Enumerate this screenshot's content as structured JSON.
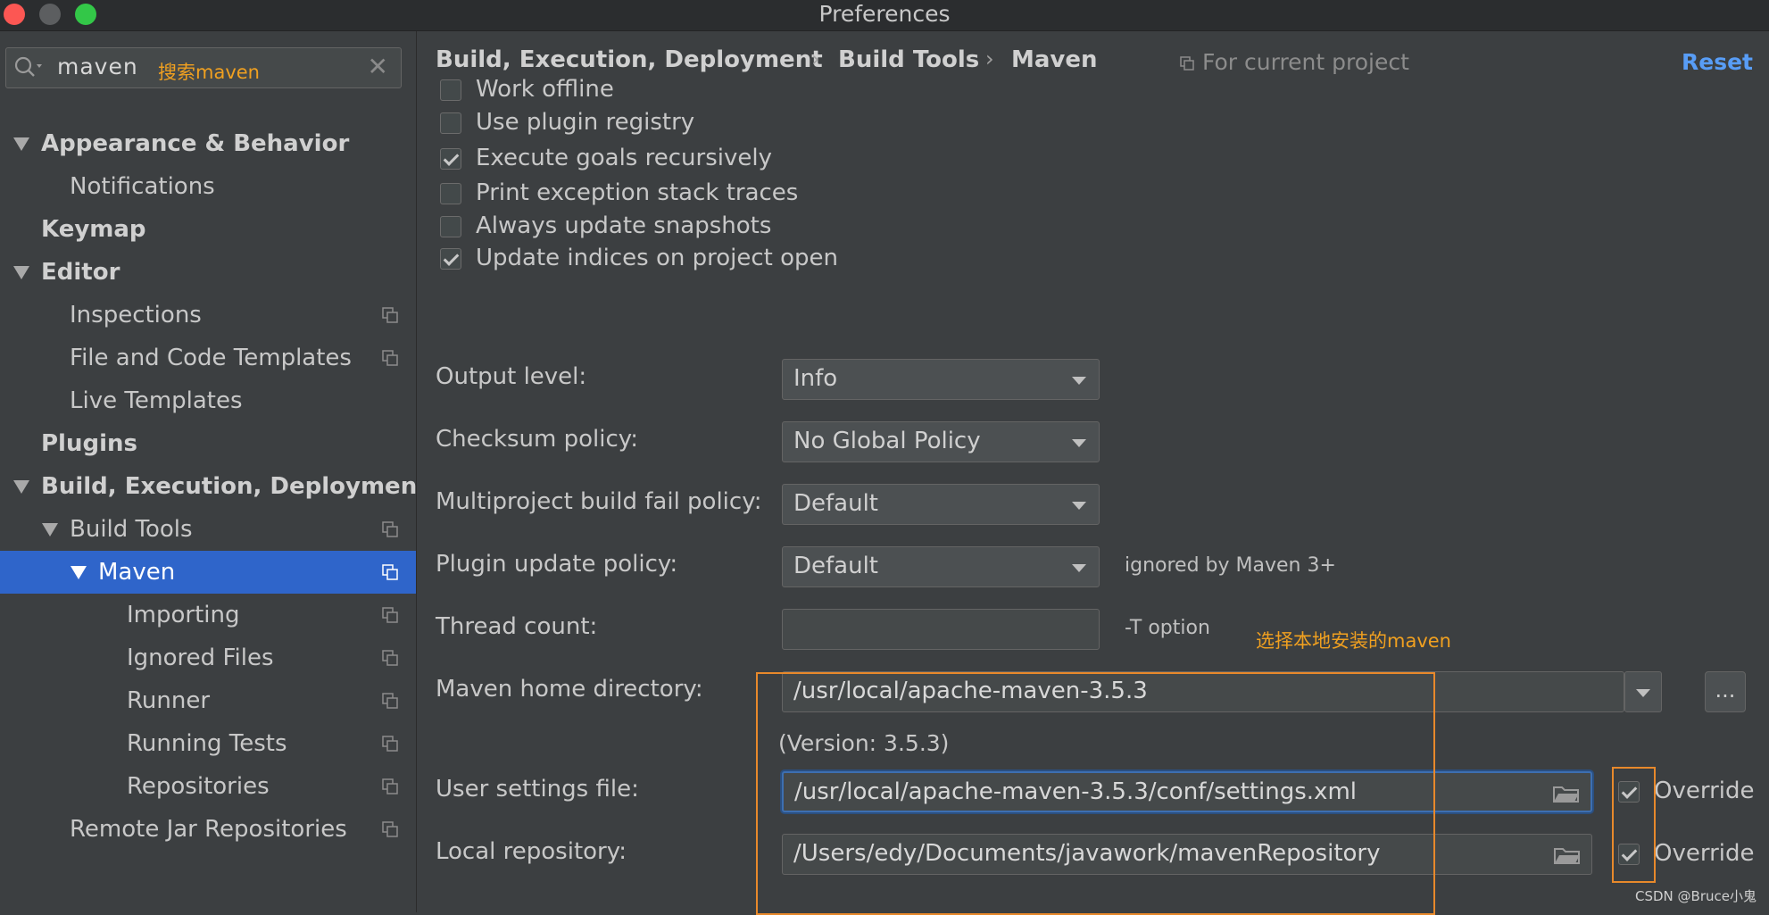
{
  "window": {
    "title": "Preferences"
  },
  "colors": {
    "accent": "#2f65ca",
    "link": "#589df6",
    "annotation": "#e8892b"
  },
  "search": {
    "value": "maven",
    "annotation": "搜索maven",
    "clear_icon": "close-icon"
  },
  "sidebar": {
    "items": [
      {
        "label": "Appearance & Behavior",
        "level": 0,
        "bold": true,
        "expanded": true,
        "copy": false,
        "selected": false
      },
      {
        "label": "Notifications",
        "level": 1,
        "bold": false,
        "expanded": false,
        "copy": false,
        "selected": false
      },
      {
        "label": "Keymap",
        "level": 0,
        "bold": true,
        "expanded": false,
        "copy": false,
        "selected": false
      },
      {
        "label": "Editor",
        "level": 0,
        "bold": true,
        "expanded": true,
        "copy": false,
        "selected": false
      },
      {
        "label": "Inspections",
        "level": 1,
        "bold": false,
        "expanded": false,
        "copy": true,
        "selected": false
      },
      {
        "label": "File and Code Templates",
        "level": 1,
        "bold": false,
        "expanded": false,
        "copy": true,
        "selected": false
      },
      {
        "label": "Live Templates",
        "level": 1,
        "bold": false,
        "expanded": false,
        "copy": false,
        "selected": false
      },
      {
        "label": "Plugins",
        "level": 0,
        "bold": true,
        "expanded": false,
        "copy": false,
        "selected": false
      },
      {
        "label": "Build, Execution, Deployment",
        "level": 0,
        "bold": true,
        "expanded": true,
        "copy": false,
        "selected": false
      },
      {
        "label": "Build Tools",
        "level": 1,
        "bold": false,
        "expanded": true,
        "copy": true,
        "selected": false
      },
      {
        "label": "Maven",
        "level": 2,
        "bold": false,
        "expanded": true,
        "copy": true,
        "selected": true
      },
      {
        "label": "Importing",
        "level": 3,
        "bold": false,
        "expanded": false,
        "copy": true,
        "selected": false
      },
      {
        "label": "Ignored Files",
        "level": 3,
        "bold": false,
        "expanded": false,
        "copy": true,
        "selected": false
      },
      {
        "label": "Runner",
        "level": 3,
        "bold": false,
        "expanded": false,
        "copy": true,
        "selected": false
      },
      {
        "label": "Running Tests",
        "level": 3,
        "bold": false,
        "expanded": false,
        "copy": true,
        "selected": false
      },
      {
        "label": "Repositories",
        "level": 3,
        "bold": false,
        "expanded": false,
        "copy": true,
        "selected": false
      },
      {
        "label": "Remote Jar Repositories",
        "level": 1,
        "bold": false,
        "expanded": false,
        "copy": true,
        "selected": false
      }
    ]
  },
  "header": {
    "breadcrumb": [
      "Build, Execution, Deployment",
      "Build Tools",
      "Maven"
    ],
    "separator": "›",
    "scope": "For current project",
    "reset": "Reset"
  },
  "options": [
    {
      "label": "Work offline",
      "checked": false
    },
    {
      "label": "Use plugin registry",
      "checked": false
    },
    {
      "label": "Execute goals recursively",
      "checked": true
    },
    {
      "label": "Print exception stack traces",
      "checked": false
    },
    {
      "label": "Always update snapshots",
      "checked": false
    },
    {
      "label": "Update indices on project open",
      "checked": true
    }
  ],
  "form": {
    "output_level": {
      "label": "Output level:",
      "value": "Info"
    },
    "checksum_policy": {
      "label": "Checksum policy:",
      "value": "No Global Policy"
    },
    "fail_policy": {
      "label": "Multiproject build fail policy:",
      "value": "Default"
    },
    "plugin_update": {
      "label": "Plugin update policy:",
      "value": "Default",
      "hint": "ignored by Maven 3+"
    },
    "thread_count": {
      "label": "Thread count:",
      "value": "",
      "hint": "-T option"
    },
    "maven_home": {
      "label": "Maven home directory:",
      "value": "/usr/local/apache-maven-3.5.3",
      "browse": "...",
      "version": "(Version: 3.5.3)",
      "annotation": "选择本地安装的maven"
    },
    "user_settings": {
      "label": "User settings file:",
      "value": "/usr/local/apache-maven-3.5.3/conf/settings.xml",
      "override_label": "Override",
      "override": true
    },
    "local_repo": {
      "label": "Local repository:",
      "value": "/Users/edy/Documents/javawork/mavenRepository",
      "override_label": "Override",
      "override": true
    }
  },
  "watermark": "CSDN @Bruce小鬼"
}
